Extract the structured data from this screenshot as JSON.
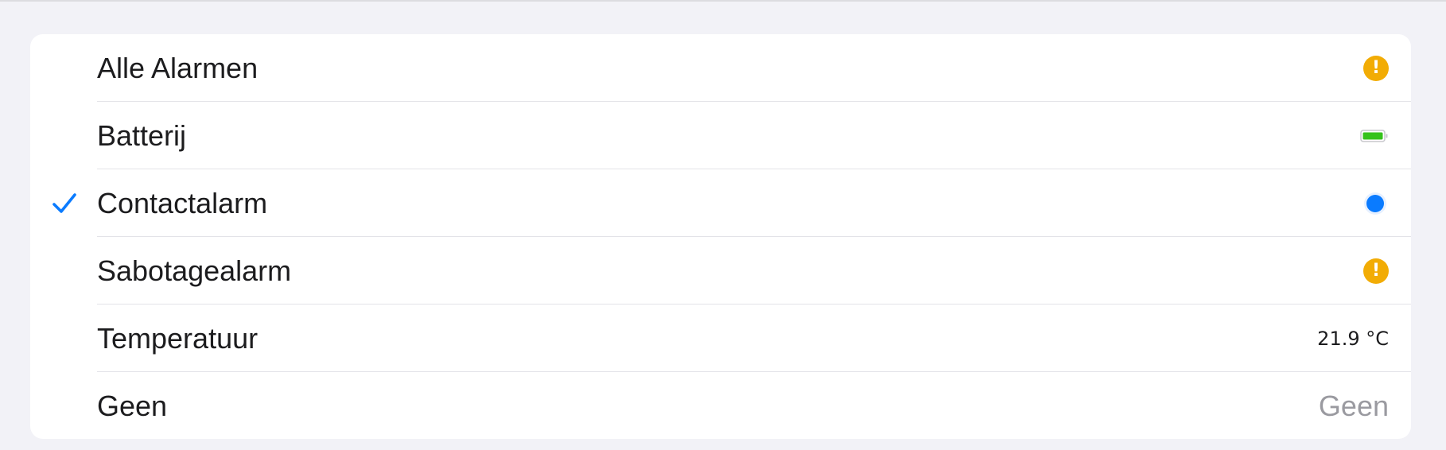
{
  "colors": {
    "background": "#f2f2f7",
    "card": "#ffffff",
    "accent": "#0a7bff",
    "warning": "#f2ac05",
    "battery": "#35c21b",
    "secondary_text": "#9a9aa0"
  },
  "list": {
    "items": [
      {
        "label": "Alle Alarmen",
        "accessory": "warning-icon",
        "selected": false
      },
      {
        "label": "Batterij",
        "accessory": "battery-icon",
        "battery_level": 1.0,
        "selected": false
      },
      {
        "label": "Contactalarm",
        "accessory": "blue-dot-icon",
        "selected": true
      },
      {
        "label": "Sabotagealarm",
        "accessory": "warning-icon",
        "selected": false
      },
      {
        "label": "Temperatuur",
        "accessory": "text",
        "value": "21.9 °C",
        "selected": false
      },
      {
        "label": "Geen",
        "accessory": "text",
        "value": "Geen",
        "selected": false
      }
    ]
  }
}
